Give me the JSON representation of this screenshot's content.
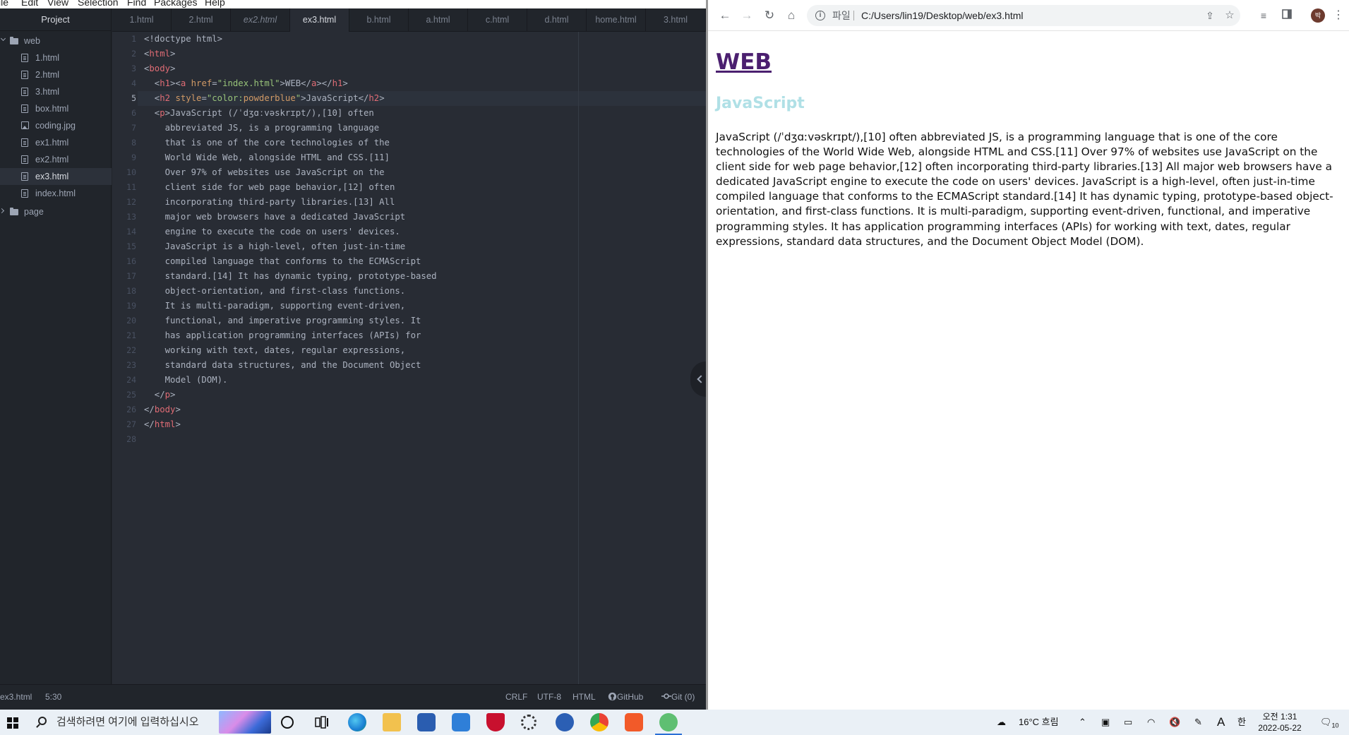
{
  "atom": {
    "menu": [
      "ile",
      "Edit",
      "View",
      "Selection",
      "Find",
      "Packages",
      "Help"
    ],
    "tree": {
      "header": "Project",
      "root": "web",
      "files": [
        "1.html",
        "2.html",
        "3.html",
        "box.html",
        "coding.jpg",
        "ex1.html",
        "ex2.html",
        "ex3.html",
        "index.html"
      ],
      "selected": "ex3.html",
      "other_folder": "page"
    },
    "tabs": [
      "1.html",
      "2.html",
      "ex2.html",
      "ex3.html",
      "b.html",
      "a.html",
      "c.html",
      "d.html",
      "home.html",
      "3.html"
    ],
    "active_tab": "ex3.html",
    "current_line": 5,
    "code_lines": [
      [
        [
          "p",
          "<!doctype html>"
        ]
      ],
      [
        [
          "p",
          "<"
        ],
        [
          "t",
          "html"
        ],
        [
          "p",
          ">"
        ]
      ],
      [
        [
          "p",
          "<"
        ],
        [
          "t",
          "body"
        ],
        [
          "p",
          ">"
        ]
      ],
      [
        [
          "p",
          "  <"
        ],
        [
          "t",
          "h1"
        ],
        [
          "p",
          "><"
        ],
        [
          "t",
          "a"
        ],
        [
          "p",
          " "
        ],
        [
          "a",
          "href"
        ],
        [
          "p",
          "="
        ],
        [
          "s",
          "\"index.html\""
        ],
        [
          "p",
          ">WEB</"
        ],
        [
          "t",
          "a"
        ],
        [
          "p",
          "></"
        ],
        [
          "t",
          "h1"
        ],
        [
          "p",
          ">"
        ]
      ],
      [
        [
          "p",
          "  <"
        ],
        [
          "t",
          "h2"
        ],
        [
          "p",
          " "
        ],
        [
          "a",
          "style"
        ],
        [
          "p",
          "="
        ],
        [
          "s",
          "\"color:"
        ],
        [
          "a",
          "powderblue"
        ],
        [
          "s",
          "\""
        ],
        [
          "p",
          ">JavaScript</"
        ],
        [
          "t",
          "h2"
        ],
        [
          "p",
          ">"
        ]
      ],
      [
        [
          "p",
          "  <"
        ],
        [
          "t",
          "p"
        ],
        [
          "p",
          ">JavaScript (/ˈdʒɑːvəskrɪpt/),[10] often"
        ]
      ],
      [
        [
          "p",
          "    abbreviated JS, is a programming language"
        ]
      ],
      [
        [
          "p",
          "    that is one of the core technologies of the"
        ]
      ],
      [
        [
          "p",
          "    World Wide Web, alongside HTML and CSS.[11]"
        ]
      ],
      [
        [
          "p",
          "    Over 97% of websites use JavaScript on the"
        ]
      ],
      [
        [
          "p",
          "    client side for web page behavior,[12] often"
        ]
      ],
      [
        [
          "p",
          "    incorporating third-party libraries.[13] All"
        ]
      ],
      [
        [
          "p",
          "    major web browsers have a dedicated JavaScript"
        ]
      ],
      [
        [
          "p",
          "    engine to execute the code on users' devices."
        ]
      ],
      [
        [
          "p",
          "    JavaScript is a high-level, often just-in-time"
        ]
      ],
      [
        [
          "p",
          "    compiled language that conforms to the ECMAScript"
        ]
      ],
      [
        [
          "p",
          "    standard.[14] It has dynamic typing, prototype-based"
        ]
      ],
      [
        [
          "p",
          "    object-orientation, and first-class functions."
        ]
      ],
      [
        [
          "p",
          "    It is multi-paradigm, supporting event-driven,"
        ]
      ],
      [
        [
          "p",
          "    functional, and imperative programming styles. It"
        ]
      ],
      [
        [
          "p",
          "    has application programming interfaces (APIs) for"
        ]
      ],
      [
        [
          "p",
          "    working with text, dates, regular expressions,"
        ]
      ],
      [
        [
          "p",
          "    standard data structures, and the Document Object"
        ]
      ],
      [
        [
          "p",
          "    Model (DOM)."
        ]
      ],
      [
        [
          "p",
          "  </"
        ],
        [
          "t",
          "p"
        ],
        [
          "p",
          ">"
        ]
      ],
      [
        [
          "p",
          "</"
        ],
        [
          "t",
          "body"
        ],
        [
          "p",
          ">"
        ]
      ],
      [
        [
          "p",
          "</"
        ],
        [
          "t",
          "html"
        ],
        [
          "p",
          ">"
        ]
      ],
      [
        [
          "p",
          ""
        ]
      ]
    ],
    "status": {
      "file": "ex3.html",
      "cursor": "5:30",
      "line_ending": "CRLF",
      "encoding": "UTF-8",
      "grammar": "HTML",
      "github": "GitHub",
      "git": "Git (0)"
    }
  },
  "browser": {
    "file_chip": "파일",
    "url": "C:/Users/lin19/Desktop/web/ex3.html",
    "avatar_initial": "박",
    "page": {
      "h1_link": "WEB",
      "h2": "JavaScript",
      "paragraph": "JavaScript (/ˈdʒɑːvəskrɪpt/),[10] often abbreviated JS, is a programming language that is one of the core technologies of the World Wide Web, alongside HTML and CSS.[11] Over 97% of websites use JavaScript on the client side for web page behavior,[12] often incorporating third-party libraries.[13] All major web browsers have a dedicated JavaScript engine to execute the code on users' devices. JavaScript is a high-level, often just-in-time compiled language that conforms to the ECMAScript standard.[14] It has dynamic typing, prototype-based object-orientation, and first-class functions. It is multi-paradigm, supporting event-driven, functional, and imperative programming styles. It has application programming interfaces (APIs) for working with text, dates, regular expressions, standard data structures, and the Document Object Model (DOM)."
    }
  },
  "taskbar": {
    "search_placeholder": "검색하려면 여기에 입력하십시오",
    "weather": "16°C 흐림",
    "ime_a": "A",
    "ime_han": "한",
    "time": "오전 1:31",
    "date": "2022-05-22",
    "notifications": "10"
  }
}
